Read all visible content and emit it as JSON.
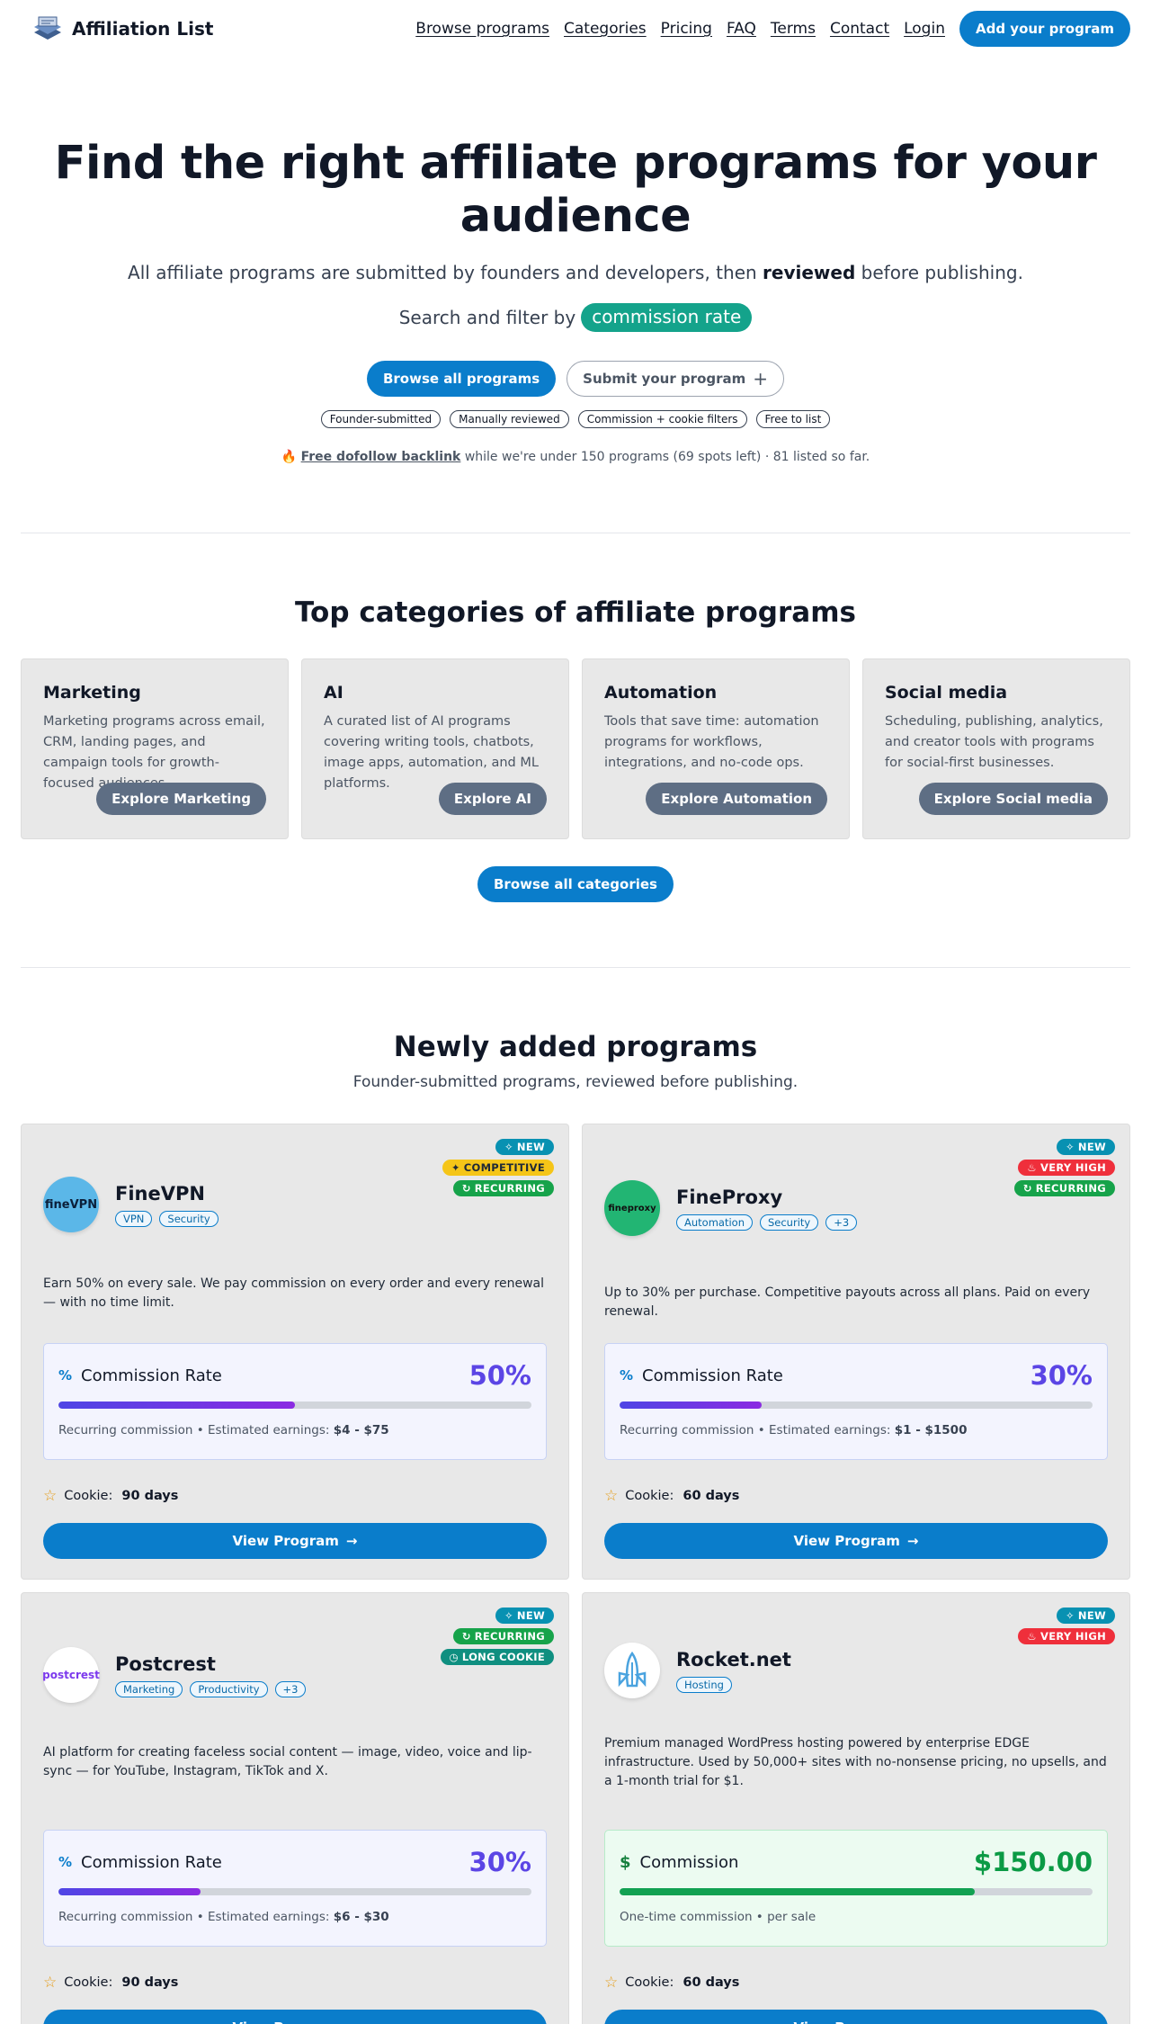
{
  "brand": {
    "name": "Affiliation List",
    "logo_icon": "stack-logo-icon"
  },
  "nav": {
    "links": [
      "Browse programs",
      "Categories",
      "Pricing",
      "FAQ",
      "Terms",
      "Contact",
      "Login"
    ],
    "cta": "Add your program"
  },
  "hero": {
    "title": "Find the right affiliate programs for your audience",
    "sub_before": "All affiliate programs are submitted by founders and developers, then ",
    "sub_bold": "reviewed",
    "sub_after": " before publishing.",
    "filter_text": "Search and filter by",
    "filter_pill": "commission rate",
    "browse_button": "Browse all programs",
    "submit_button": "Submit your program",
    "submit_icon": "+",
    "chips": [
      "Founder-submitted",
      "Manually reviewed",
      "Commission + cookie filters",
      "Free to list"
    ],
    "backlink_emoji": "🔥",
    "backlink_link": "Free dofollow backlink",
    "backlink_rest": " while we're under 150 programs (69 spots left) · 81 listed so far."
  },
  "categories": {
    "title": "Top categories of affiliate programs",
    "items": [
      {
        "title": "Marketing",
        "desc": "Marketing programs across email, CRM, landing pages, and campaign tools for growth-focused audiences.",
        "button": "Explore Marketing"
      },
      {
        "title": "AI",
        "desc": "A curated list of AI programs covering writing tools, chatbots, image apps, automation, and ML platforms.",
        "button": "Explore AI"
      },
      {
        "title": "Automation",
        "desc": "Tools that save time: automation programs for workflows, integrations, and no-code ops.",
        "button": "Explore Automation"
      },
      {
        "title": "Social media",
        "desc": "Scheduling, publishing, analytics, and creator tools with programs for social-first businesses.",
        "button": "Explore Social media"
      }
    ],
    "browse_button": "Browse all categories"
  },
  "new_programs": {
    "title": "Newly added programs",
    "subtitle": "Founder-submitted programs, reviewed before publishing.",
    "cookie_label": "Cookie:",
    "view_button": "View Program",
    "programs": [
      {
        "name": "FineVPN",
        "logo_text": "fineVPN",
        "tags": [
          "VPN",
          "Security"
        ],
        "badges": [
          "NEW",
          "COMPETITIVE",
          "RECURRING"
        ],
        "desc": "Earn 50% on every sale. We pay commission on every order and every renewal — with no time limit.",
        "commission_label": "Commission Rate",
        "commission_symbol": "%",
        "commission_value": "50%",
        "bar_fraction": 0.5,
        "note_prefix": "Recurring commission • Estimated earnings: ",
        "note_bold": "$4 - $75",
        "cookie_days": "90 days"
      },
      {
        "name": "FineProxy",
        "logo_text": "fineproxy",
        "tags": [
          "Automation",
          "Security",
          "+3"
        ],
        "badges": [
          "NEW",
          "VERY HIGH",
          "RECURRING"
        ],
        "desc": "Up to 30% per purchase. Competitive payouts across all plans. Paid on every renewal.",
        "commission_label": "Commission Rate",
        "commission_symbol": "%",
        "commission_value": "30%",
        "bar_fraction": 0.3,
        "note_prefix": "Recurring commission • Estimated earnings: ",
        "note_bold": "$1 - $1500",
        "cookie_days": "60 days"
      },
      {
        "name": "Postcrest",
        "logo_text": "postcrest",
        "tags": [
          "Marketing",
          "Productivity",
          "+3"
        ],
        "badges": [
          "NEW",
          "RECURRING",
          "LONG COOKIE"
        ],
        "desc": "AI platform for creating faceless social content — image, video, voice and lip-sync — for YouTube, Instagram, TikTok and X.",
        "commission_label": "Commission Rate",
        "commission_symbol": "%",
        "commission_value": "30%",
        "bar_fraction": 0.3,
        "note_prefix": "Recurring commission • Estimated earnings: ",
        "note_bold": "$6 - $30",
        "cookie_days": "90 days"
      },
      {
        "name": "Rocket.net",
        "logo_text": "",
        "tags": [
          "Hosting"
        ],
        "badges": [
          "NEW",
          "VERY HIGH"
        ],
        "desc": "Premium managed WordPress hosting powered by enterprise EDGE infrastructure. Used by 50,000+ sites with no-nonsense pricing, no upsells, and a 1-month trial for $1.",
        "commission_label": "Commission",
        "commission_symbol": "$",
        "commission_value": "$150.00",
        "bar_fraction": 0.75,
        "note_prefix": "One-time commission • per sale",
        "note_bold": "",
        "cookie_days": "60 days"
      }
    ]
  },
  "colors": {
    "accent": "#0a7dcb",
    "teal": "#14a38b",
    "purple": "#5b45e5",
    "green": "#0b9a45"
  }
}
